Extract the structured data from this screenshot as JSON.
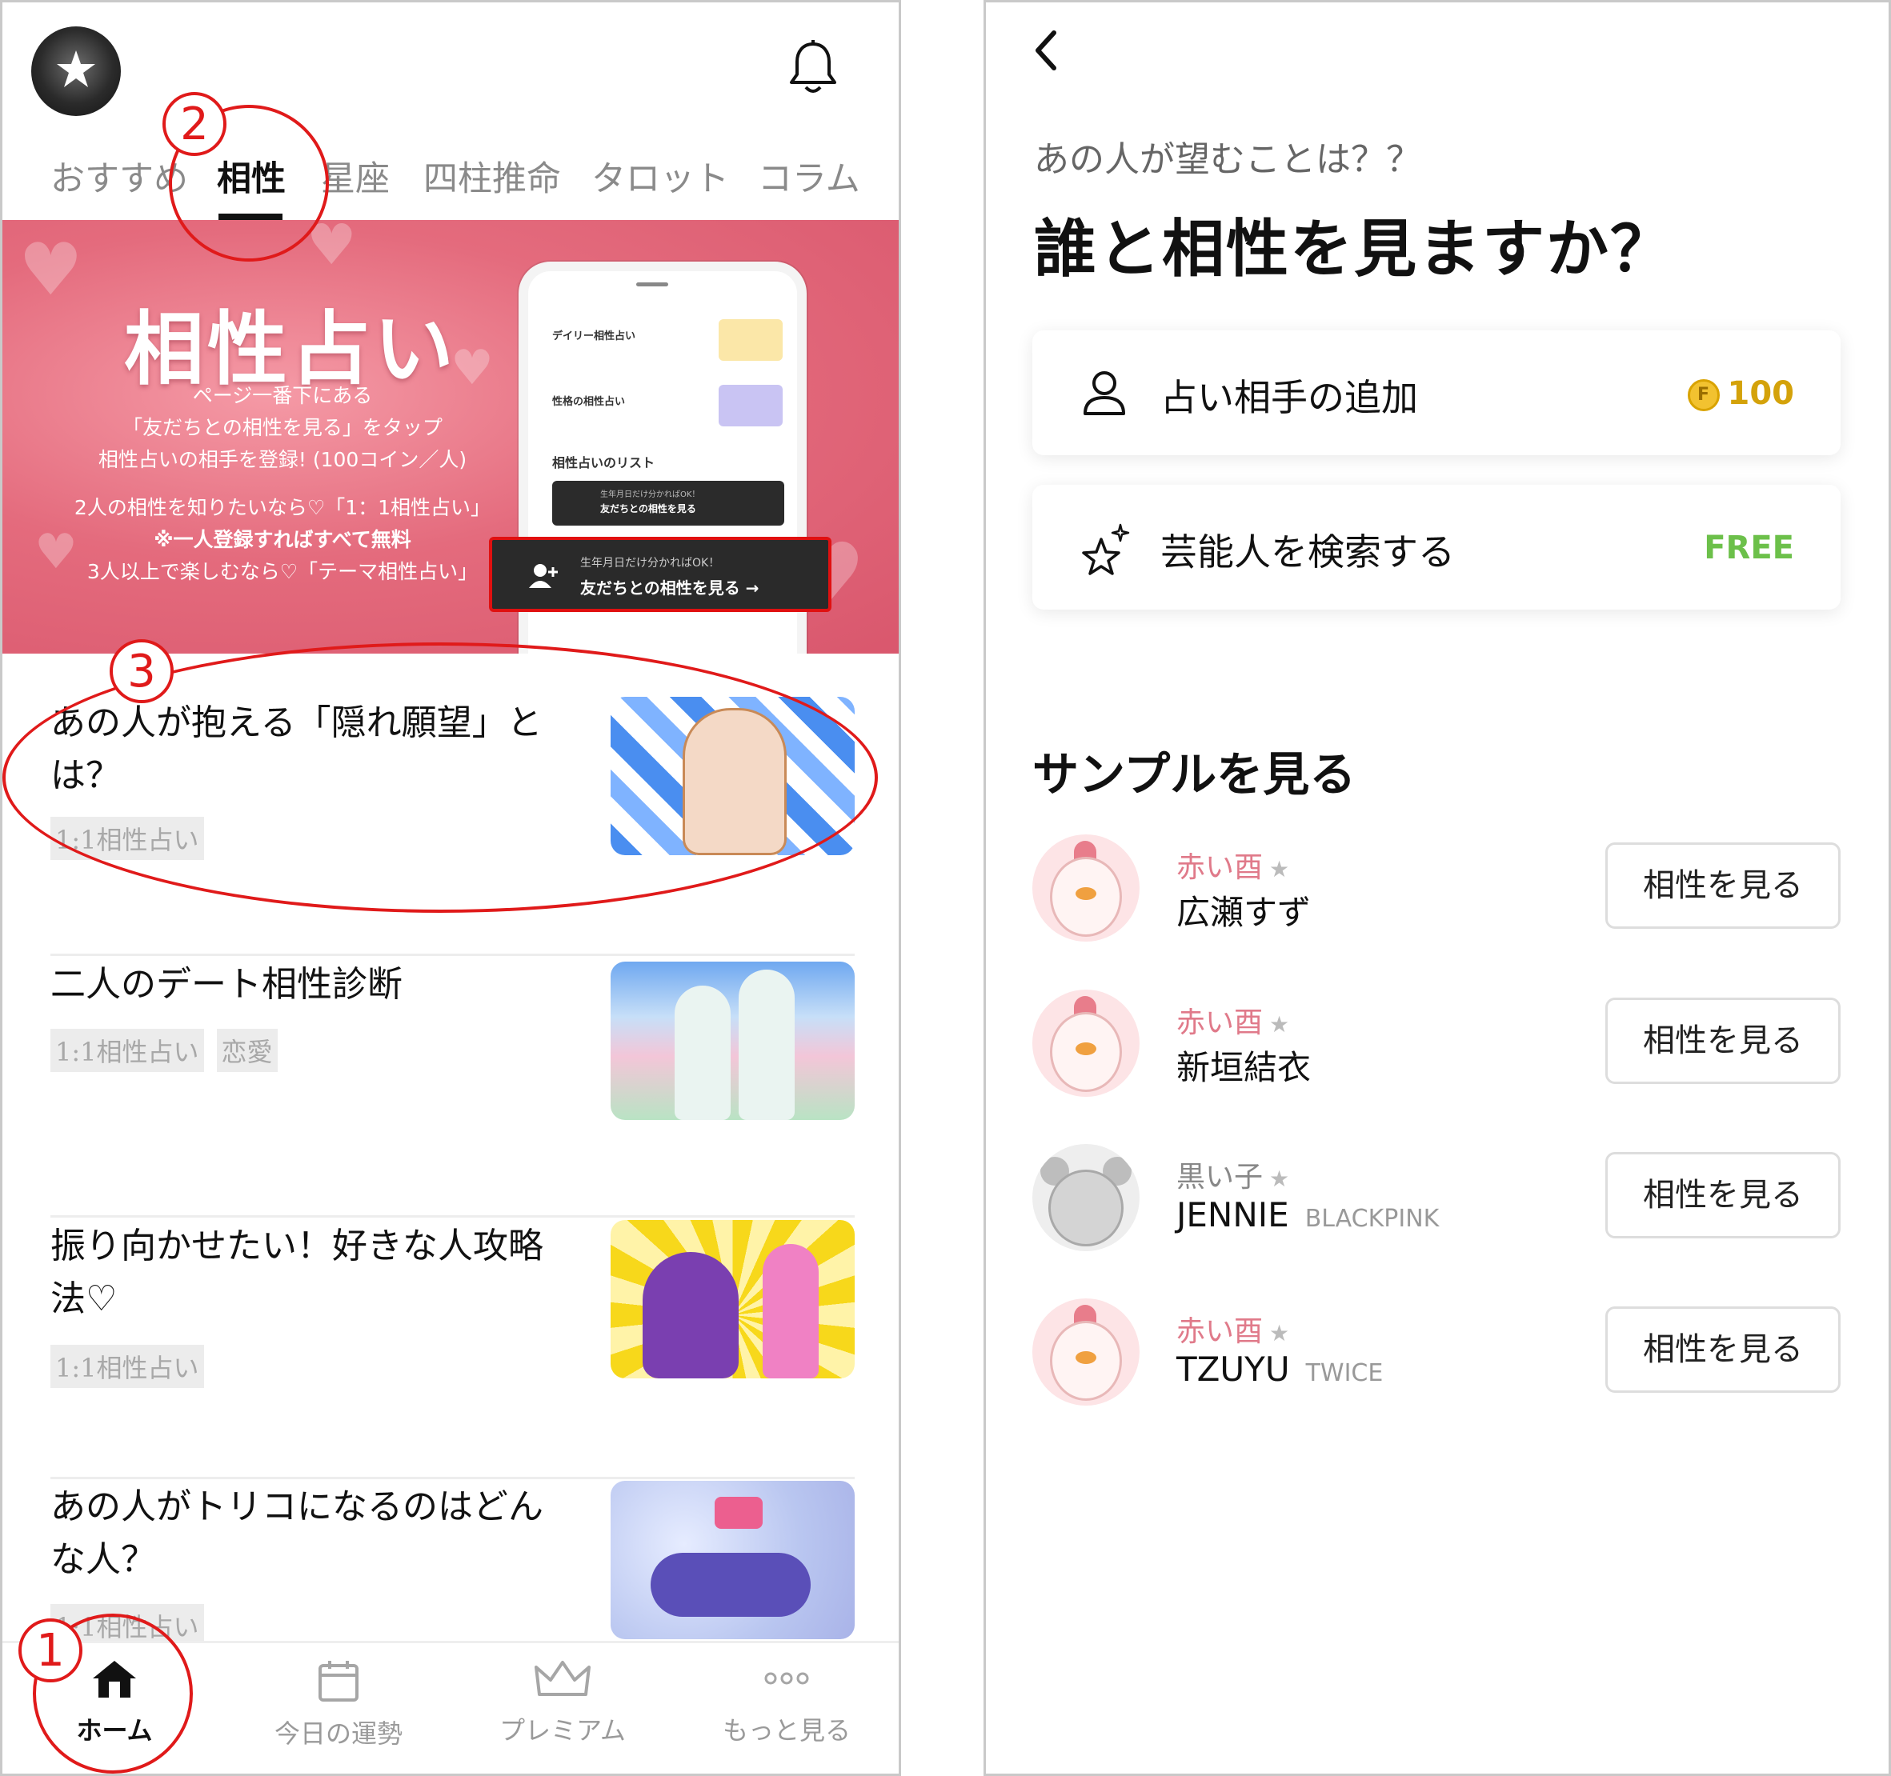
{
  "left": {
    "tabs": [
      "おすすめ",
      "相性",
      "星座",
      "四柱推命",
      "タロット",
      "コラム"
    ],
    "active_tab": "相性",
    "banner": {
      "title": "相性占い",
      "lines": [
        "ページ一番下にある",
        "「友だちとの相性を見る」をタップ",
        "相性占いの相手を登録! (100コイン／人)",
        "2人の相性を知りたいなら♡「1：1相性占い」",
        "※一人登録すればすべて無料",
        "3人以上で楽しむなら♡「テーマ相性占い」"
      ],
      "mock": {
        "row1": "デイリー相性占い",
        "row2": "性格の相性占い",
        "list_heading": "相性占いのリスト",
        "dark_small": "生年月日だけ分かればOK！",
        "dark_big": "友だちとの相性を見る"
      },
      "cta_small": "生年月日だけ分かればOK！",
      "cta_big": "友だちとの相性を見る →"
    },
    "articles": [
      {
        "title": "あの人が抱える「隠れ願望」とは？",
        "tags": [
          "1:1相性占い"
        ]
      },
      {
        "title": "二人のデート相性診断",
        "tags": [
          "1:1相性占い",
          "恋愛"
        ]
      },
      {
        "title": "振り向かせたい！好きな人攻略法♡",
        "tags": [
          "1:1相性占い"
        ]
      },
      {
        "title": "あの人がトリコになるのはどんな人？",
        "tags": [
          "1:1相性占い"
        ]
      }
    ],
    "nav": [
      "ホーム",
      "今日の運勢",
      "プレミアム",
      "もっと見る"
    ],
    "active_nav": "ホーム",
    "annotations": [
      "1",
      "2",
      "3"
    ]
  },
  "right": {
    "subtitle": "あの人が望むことは？？",
    "title": "誰と相性を見ますか？",
    "cards": [
      {
        "label": "占い相手の追加",
        "price": "100",
        "coin_icon": "coin-icon",
        "price_color": "#d4a20a"
      },
      {
        "label": "芸能人を検索する",
        "price": "FREE",
        "price_color": "#6cc04a"
      }
    ],
    "sample_heading": "サンプルを見る",
    "samples": [
      {
        "type": "赤い酉",
        "name": "広瀬すず",
        "group": "",
        "type_color": "#e07a8a",
        "button": "相性を見る"
      },
      {
        "type": "赤い酉",
        "name": "新垣結衣",
        "group": "",
        "type_color": "#e07a8a",
        "button": "相性を見る"
      },
      {
        "type": "黒い子",
        "name": "JENNIE",
        "group": "BLACKPINK",
        "type_color": "#888888",
        "button": "相性を見る"
      },
      {
        "type": "赤い酉",
        "name": "TZUYU",
        "group": "TWICE",
        "type_color": "#e07a8a",
        "button": "相性を見る"
      }
    ]
  }
}
